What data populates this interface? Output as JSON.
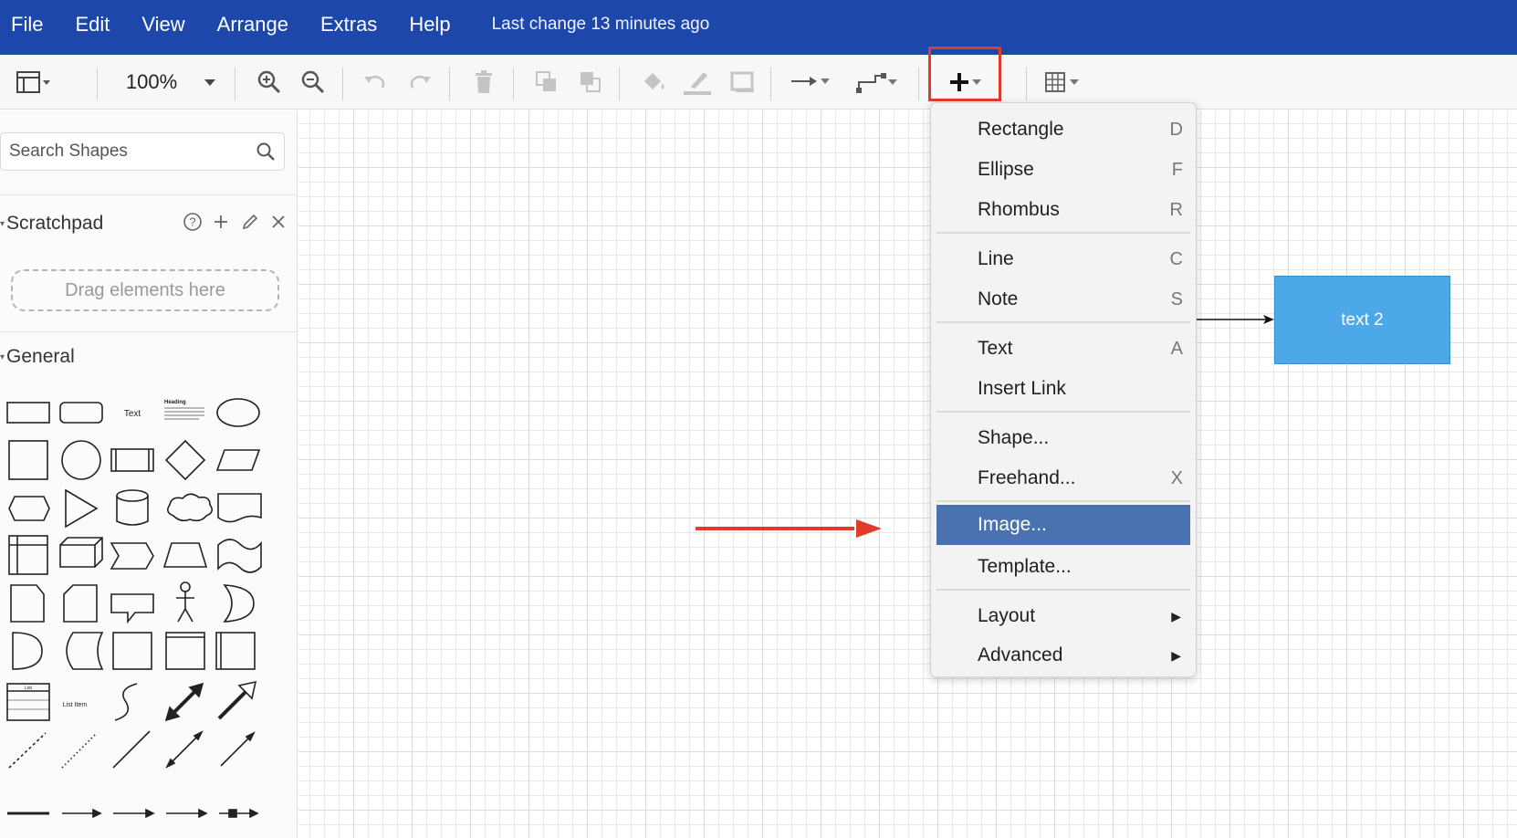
{
  "menubar": {
    "items": [
      "File",
      "Edit",
      "View",
      "Arrange",
      "Extras",
      "Help"
    ],
    "status": "Last change 13 minutes ago"
  },
  "toolbar": {
    "zoom": "100%",
    "buttons": [
      "format-panel-icon",
      "zoom-in-icon",
      "zoom-out-icon",
      "undo-icon",
      "redo-icon",
      "delete-icon",
      "to-front-icon",
      "to-back-icon",
      "fill-color-icon",
      "line-color-icon",
      "shadow-icon",
      "connection-icon",
      "waypoints-icon",
      "insert-plus-icon",
      "table-icon"
    ]
  },
  "sidebar": {
    "search_placeholder": "Search Shapes",
    "scratchpad_title": "Scratchpad",
    "dropzone_text": "Drag elements here",
    "general_title": "General",
    "shape_text_label": "Text",
    "shape_heading_label": "Heading",
    "shape_list_label": "List",
    "shape_list_item_label": "List Item"
  },
  "canvas": {
    "node_text": "text 2"
  },
  "insert_menu": {
    "items": [
      {
        "label": "Rectangle",
        "shortcut": "D"
      },
      {
        "label": "Ellipse",
        "shortcut": "F"
      },
      {
        "label": "Rhombus",
        "shortcut": "R"
      },
      {
        "label": "Line",
        "shortcut": "C"
      },
      {
        "label": "Note",
        "shortcut": "S"
      },
      {
        "label": "Text",
        "shortcut": "A"
      },
      {
        "label": "Insert Link",
        "shortcut": ""
      },
      {
        "label": "Shape...",
        "shortcut": ""
      },
      {
        "label": "Freehand...",
        "shortcut": "X"
      },
      {
        "label": "Image...",
        "shortcut": ""
      },
      {
        "label": "Template...",
        "shortcut": ""
      },
      {
        "label": "Layout",
        "shortcut": ""
      },
      {
        "label": "Advanced",
        "shortcut": ""
      }
    ],
    "active": "Image..."
  },
  "colors": {
    "menubar": "#1d47ab",
    "highlight": "#e03c2b",
    "active_item": "#4a72b0",
    "node_fill": "#4da8ea"
  }
}
